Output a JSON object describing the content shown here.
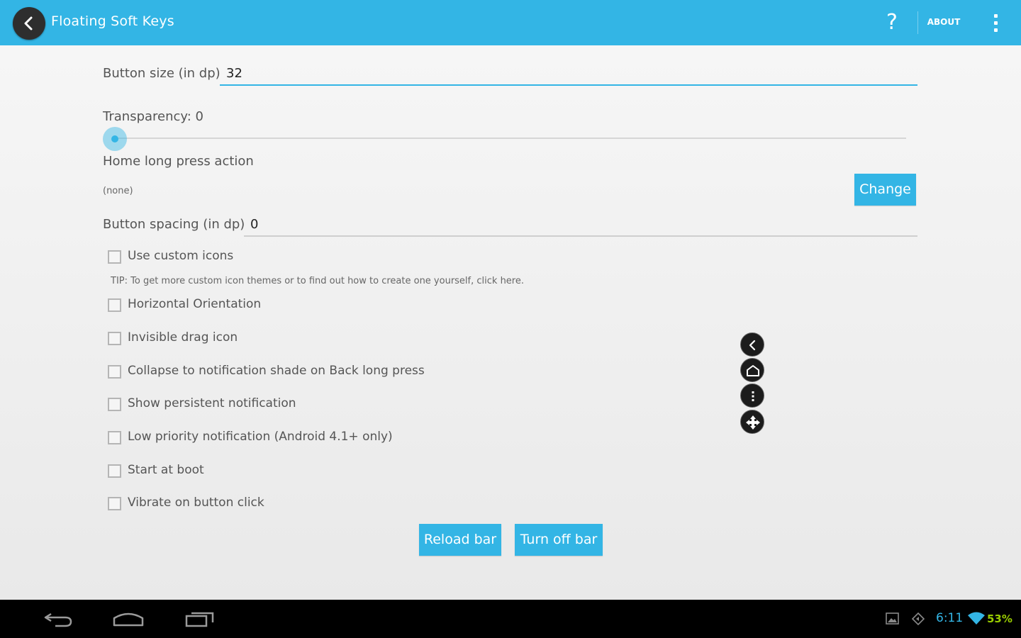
{
  "actionbar": {
    "title": "Floating Soft Keys",
    "help_label": "?",
    "about_label": "ABOUT",
    "icons": {
      "back": "back-arrow-icon",
      "overflow": "overflow-menu-icon"
    },
    "color": "#33b5e5"
  },
  "settings": {
    "button_size": {
      "label": "Button size (in dp)",
      "value": "32"
    },
    "transparency": {
      "label": "Transparency: 0",
      "value": 0
    },
    "home_long_press": {
      "label": "Home long press action",
      "value": "(none)",
      "button": "Change"
    },
    "button_spacing": {
      "label": "Button spacing (in dp)",
      "value": "0"
    },
    "tip": "TIP: To get more custom icon themes or to find out how to create one yourself, click here.",
    "checkboxes": [
      {
        "label": "Use custom icons",
        "checked": false
      },
      {
        "label": "Horizontal Orientation",
        "checked": false
      },
      {
        "label": "Invisible drag icon",
        "checked": false
      },
      {
        "label": "Collapse to notification shade on Back long press",
        "checked": false
      },
      {
        "label": "Show persistent notification",
        "checked": false
      },
      {
        "label": "Low priority notification (Android 4.1+ only)",
        "checked": false
      },
      {
        "label": "Start at boot",
        "checked": false
      },
      {
        "label": "Vibrate on button click",
        "checked": false
      }
    ],
    "reload_button": "Reload bar",
    "turn_off_button": "Turn off bar"
  },
  "floating_keys": [
    "back-icon",
    "home-icon",
    "menu-icon",
    "drag-move-icon"
  ],
  "system_bar": {
    "clock": "6:11",
    "battery": "53%",
    "icons": [
      "nav-back-icon",
      "nav-home-icon",
      "nav-recents-icon",
      "screenshot-icon",
      "location-icon",
      "wifi-icon"
    ]
  }
}
